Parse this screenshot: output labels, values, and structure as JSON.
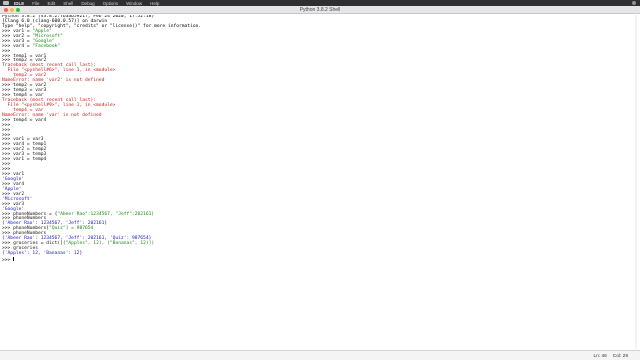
{
  "menubar": {
    "app": "IDLE",
    "items": [
      "File",
      "Edit",
      "Shell",
      "Debug",
      "Options",
      "Window",
      "Help"
    ]
  },
  "window": {
    "title": "Python 3.8.2 Shell"
  },
  "shell": {
    "lines": [
      {
        "type": "header",
        "text": "Python 3.8.2 (v3.8.2:7b3ab5921f, Feb 24 2020, 17:52:18)"
      },
      {
        "type": "header",
        "text": "[Clang 6.0 (clang-600.0.57)] on darwin"
      },
      {
        "type": "header",
        "text": "Type \"help\", \"copyright\", \"credits\" or \"license()\" for more information."
      },
      {
        "type": "prompt",
        "code": "var1 = ",
        "str": "\"Apple\""
      },
      {
        "type": "prompt",
        "code": "var2 = ",
        "str": "\"Microsoft\""
      },
      {
        "type": "prompt",
        "code": "var3 = ",
        "str": "\"Google\""
      },
      {
        "type": "prompt",
        "code": "var4 = ",
        "str": "\"Facebook\""
      },
      {
        "type": "prompt",
        "code": ""
      },
      {
        "type": "prompt",
        "code": "temp1 = var1"
      },
      {
        "type": "prompt",
        "code": "temp2 = var2"
      },
      {
        "type": "err",
        "text": "Traceback (most recent call last):"
      },
      {
        "type": "err",
        "text": "  File \"<pyshell#6>\", line 1, in <module>"
      },
      {
        "type": "err",
        "text": "    temp2 = var2"
      },
      {
        "type": "err",
        "text": "NameError: name 'var2' is not defined"
      },
      {
        "type": "prompt",
        "code": "temp2 = var2"
      },
      {
        "type": "prompt",
        "code": "temp3 = var3"
      },
      {
        "type": "prompt",
        "code": "temp4 = var"
      },
      {
        "type": "err",
        "text": "Traceback (most recent call last):"
      },
      {
        "type": "err",
        "text": "  File \"<pyshell#9>\", line 1, in <module>"
      },
      {
        "type": "err",
        "text": "    temp4 = var"
      },
      {
        "type": "err",
        "text": "NameError: name 'var' is not defined"
      },
      {
        "type": "prompt",
        "code": "temp4 = var4"
      },
      {
        "type": "prompt",
        "code": ""
      },
      {
        "type": "prompt",
        "code": ""
      },
      {
        "type": "prompt",
        "code": ""
      },
      {
        "type": "prompt",
        "code": "var1 = var3"
      },
      {
        "type": "prompt",
        "code": "var4 = temp1"
      },
      {
        "type": "prompt",
        "code": "var2 = temp2"
      },
      {
        "type": "prompt",
        "code": "var3 = temp3"
      },
      {
        "type": "prompt",
        "code": "var1 = temp4"
      },
      {
        "type": "prompt",
        "code": ""
      },
      {
        "type": "prompt",
        "code": ""
      },
      {
        "type": "prompt",
        "code": "var1"
      },
      {
        "type": "out",
        "text": "'Google'"
      },
      {
        "type": "prompt",
        "code": "var4"
      },
      {
        "type": "out",
        "text": "'Apple'"
      },
      {
        "type": "prompt",
        "code": "var2"
      },
      {
        "type": "out",
        "text": "'Microsoft'"
      },
      {
        "type": "prompt",
        "code": "var3"
      },
      {
        "type": "out",
        "text": "'Google'"
      },
      {
        "type": "prompt",
        "code": "phoneNumbers = {",
        "str": "\"Abeer Rao\":1234567, \"Jeff\":202161}"
      },
      {
        "type": "prompt",
        "code": "phoneNumbers"
      },
      {
        "type": "out",
        "text": "{'Abeer Rao': 1234567, 'Jeff': 202161}"
      },
      {
        "type": "prompt",
        "code": "phoneNumbers[",
        "str": "\"Quiz\"] = 987654"
      },
      {
        "type": "prompt",
        "code": "phoneNumbers"
      },
      {
        "type": "out",
        "text": "{'Abeer Rao': 1234567, 'Jeff': 202161, 'Quiz': 987654}"
      },
      {
        "type": "prompt",
        "code": "groceries = dict([(",
        "str": "\"Apples\", 12), (\"Bananas\", 12)])"
      },
      {
        "type": "prompt",
        "code": "groceries"
      },
      {
        "type": "out",
        "text": "{'Apples': 12, 'Bananas': 12}"
      },
      {
        "type": "prompt",
        "code": "",
        "cursor": true
      }
    ]
  },
  "status": {
    "line": "Ln: 46",
    "col": "Col: 29"
  }
}
